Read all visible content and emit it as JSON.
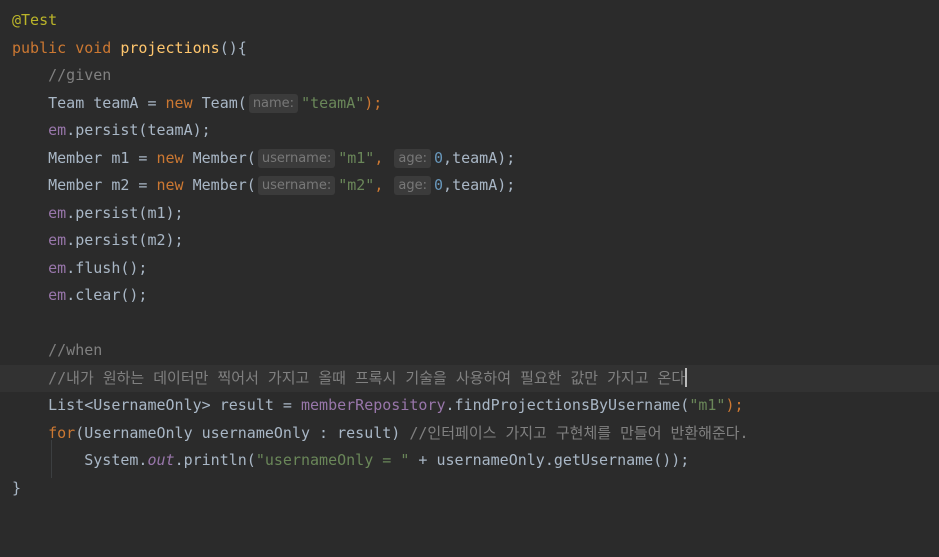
{
  "editor": {
    "annotation": "@Test",
    "method_modifiers": "public void",
    "method_name": "projections",
    "method_open": "(){",
    "comment_given": "//given",
    "team_decl": "Team teamA = ",
    "kw_new": "new",
    "team_ctor": " Team(",
    "hint_name": "name:",
    "str_teamA": "\"teamA\"",
    "close_semicolon": ");",
    "em": "em",
    "persist_teamA": ".persist(teamA);",
    "member_m1_decl": "Member m1 = ",
    "member_m2_decl": "Member m2 = ",
    "member_ctor": " Member(",
    "hint_username": "username:",
    "str_m1": "\"m1\"",
    "str_m2": "\"m2\"",
    "comma": ",",
    "hint_age": "age:",
    "num_zero": "0",
    "teamA_tail": ",teamA);",
    "persist_m1": ".persist(m1);",
    "persist_m2": ".persist(m2);",
    "flush": ".flush();",
    "clear": ".clear();",
    "comment_when": "//when",
    "comment_korean": "//내가 원하는 데이터만 찍어서 가지고 올때 프록시 기술을 사용하여 필요한 값만 가지고 온다",
    "list_decl": "List<UsernameOnly> result = ",
    "repo_field": "memberRepository",
    "find_call": ".findProjectionsByUsername(",
    "for_kw": "for",
    "for_body": "(UsernameOnly usernameOnly : result) ",
    "comment_interface": "//인터페이스 가지고 구현체를 만들어 반환해준다.",
    "system": "System.",
    "out": "out",
    "println_open": ".println(",
    "str_prefix": "\"usernameOnly = \"",
    "concat_tail": " + usernameOnly.getUsername());",
    "closing_brace": "}"
  }
}
